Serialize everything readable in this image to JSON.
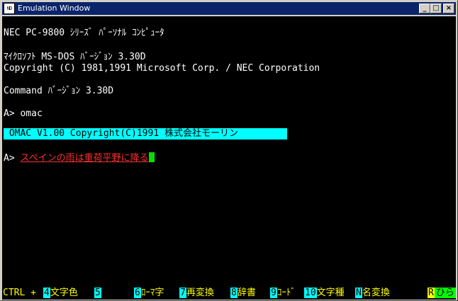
{
  "window": {
    "icon_text": "ND",
    "title": "Emulation Window",
    "buttons": {
      "minimize": "_",
      "maximize": "□",
      "close": "×"
    }
  },
  "screen": {
    "lines": [
      "NEC PC-9800 ｼﾘｰｽﾞ ﾊﾟｰｿﾅﾙ ｺﾝﾋﾟｭｰﾀ",
      "ﾏｲｸﾛｿﾌﾄ MS-DOS ﾊﾞｰｼﾞｮﾝ 3.30D",
      "Copyright (C) 1981,1991 Microsoft Corp. / NEC Corporation",
      "Command ﾊﾞｰｼﾞｮﾝ 3.30D",
      "A> omac"
    ],
    "omac_banner": " OMAC V1.00 Copyright(C)1991 株式会社モーリン",
    "prompt": "A> ",
    "input_text": "スペインの雨は重荷平野に降る"
  },
  "fkeys": {
    "ctrl_label": "CTRL +",
    "keys": [
      {
        "num": "4",
        "label": "文字色"
      },
      {
        "num": "5",
        "label": ""
      },
      {
        "num": "6",
        "label": "ﾛｰﾏ字"
      },
      {
        "num": "7",
        "label": "再変換"
      },
      {
        "num": "8",
        "label": "辞書"
      },
      {
        "num": "9",
        "label": "ｺｰﾄﾞ"
      },
      {
        "num": "10",
        "label": "文字種"
      },
      {
        "num": "N",
        "label": "名変換"
      }
    ],
    "mode_r": "R",
    "mode_hira": "ひら"
  },
  "colors": {
    "titlebar": "#0a246a",
    "banner": "#00ffff",
    "input_text": "#ff3030",
    "cursor": "#00e000",
    "fkey_label": "#ffff00"
  }
}
